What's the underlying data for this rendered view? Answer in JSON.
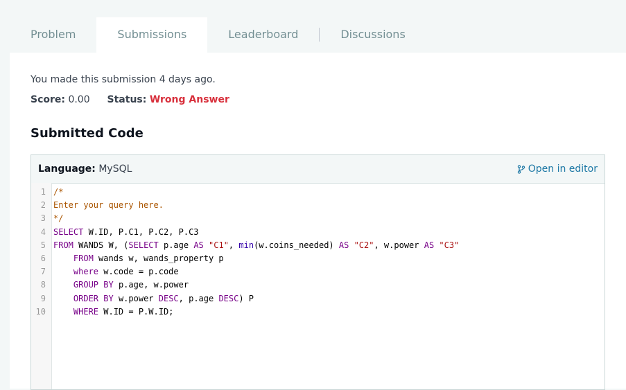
{
  "tabs": [
    {
      "label": "Problem",
      "active": false
    },
    {
      "label": "Submissions",
      "active": true
    },
    {
      "label": "Leaderboard",
      "active": false
    },
    {
      "label": "Discussions",
      "active": false
    }
  ],
  "submission": {
    "meta": "You made this submission 4 days ago.",
    "score_label": "Score:",
    "score_value": "0.00",
    "status_label": "Status:",
    "status_value": "Wrong Answer"
  },
  "code_section": {
    "title": "Submitted Code",
    "language_label": "Language:",
    "language_value": "MySQL",
    "open_editor_label": "Open in editor"
  },
  "colors": {
    "accent_link": "#1d78a5",
    "status_wrong": "#d8303c",
    "comment": "#aa5500",
    "keyword": "#770088"
  },
  "code": [
    {
      "n": "1",
      "text": "/*"
    },
    {
      "n": "2",
      "text": "Enter your query here."
    },
    {
      "n": "3",
      "text": "*/"
    },
    {
      "n": "4",
      "text": "SELECT W.ID, P.C1, P.C2, P.C3"
    },
    {
      "n": "5",
      "text": "FROM WANDS W, (SELECT p.age AS \"C1\", min(w.coins_needed) AS \"C2\", w.power AS \"C3\""
    },
    {
      "n": "6",
      "text": "    FROM wands w, wands_property p"
    },
    {
      "n": "7",
      "text": "    where w.code = p.code"
    },
    {
      "n": "8",
      "text": "    GROUP BY p.age, w.power"
    },
    {
      "n": "9",
      "text": "    ORDER BY w.power DESC, p.age DESC) P"
    },
    {
      "n": "10",
      "text": "    WHERE W.ID = P.W.ID;"
    }
  ]
}
